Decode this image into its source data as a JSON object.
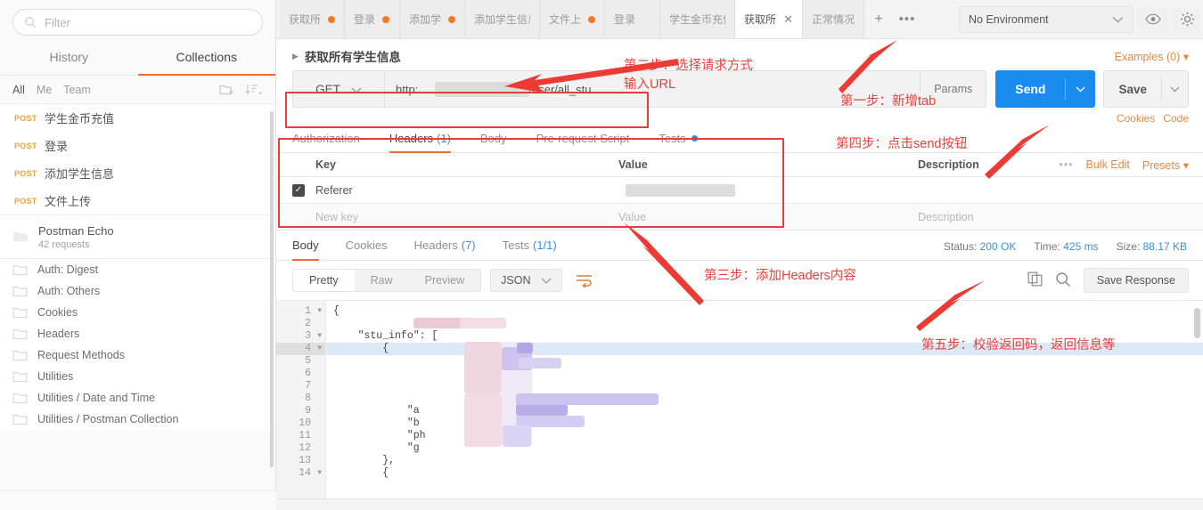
{
  "sidebar": {
    "filter_placeholder": "Filter",
    "tabs": [
      {
        "label": "History",
        "active": false
      },
      {
        "label": "Collections",
        "active": true
      }
    ],
    "scope_filters": [
      {
        "label": "All",
        "active": true
      },
      {
        "label": "Me",
        "active": false
      },
      {
        "label": "Team",
        "active": false
      }
    ],
    "new_folder_icon": "new-folder-icon",
    "sort_icon": "sort-descending-icon",
    "requests": [
      {
        "method": "POST",
        "name": "学生金币充值"
      },
      {
        "method": "POST",
        "name": "登录"
      },
      {
        "method": "POST",
        "name": "添加学生信息"
      },
      {
        "method": "POST",
        "name": "文件上传"
      }
    ],
    "collection": {
      "name": "Postman Echo",
      "meta": "42 requests"
    },
    "folders": [
      "Auth: Digest",
      "Auth: Others",
      "Cookies",
      "Headers",
      "Request Methods",
      "Utilities",
      "Utilities / Date and Time",
      "Utilities / Postman Collection"
    ]
  },
  "tabbar": {
    "tabs": [
      {
        "label": "获取所",
        "dirty": true,
        "active": false,
        "closable": false
      },
      {
        "label": "登录",
        "dirty": true,
        "active": false,
        "closable": false
      },
      {
        "label": "添加学",
        "dirty": true,
        "active": false,
        "closable": false
      },
      {
        "label": "添加学生信息",
        "dirty": false,
        "active": false,
        "closable": false
      },
      {
        "label": "文件上",
        "dirty": true,
        "active": false,
        "closable": false
      },
      {
        "label": "登录",
        "dirty": false,
        "active": false,
        "closable": false
      },
      {
        "label": "学生金币充值",
        "dirty": false,
        "active": false,
        "closable": false
      },
      {
        "label": "获取所",
        "dirty": false,
        "active": true,
        "closable": true
      },
      {
        "label": "正常情况",
        "dirty": false,
        "active": false,
        "closable": false
      }
    ],
    "add_label": "+",
    "more_label": "•••",
    "environment": "No Environment",
    "eye_icon": "eye-icon",
    "gear_icon": "gear-icon"
  },
  "request": {
    "title": "获取所有学生信息",
    "examples_label": "Examples (0)",
    "method": "GET",
    "url_prefix": "http:",
    "url_suffix": "pi/user/all_stu",
    "params_label": "Params",
    "send_label": "Send",
    "save_label": "Save",
    "cookies_label": "Cookies",
    "code_label": "Code",
    "tabs": [
      {
        "label": "Authorization",
        "count": "",
        "active": false,
        "dot": false
      },
      {
        "label": "Headers",
        "count": "(1)",
        "active": true,
        "dot": false
      },
      {
        "label": "Body",
        "count": "",
        "active": false,
        "dot": false
      },
      {
        "label": "Pre-request Script",
        "count": "",
        "active": false,
        "dot": false
      },
      {
        "label": "Tests",
        "count": "",
        "active": false,
        "dot": true
      }
    ],
    "headers_table": {
      "columns": [
        "Key",
        "Value",
        "Description"
      ],
      "bulk_edit_label": "Bulk Edit",
      "presets_label": "Presets",
      "more_label": "•••",
      "rows": [
        {
          "checked": true,
          "key": "Referer",
          "value": "",
          "description": ""
        }
      ],
      "new_row": {
        "key": "New key",
        "value": "Value",
        "description": "Description"
      }
    }
  },
  "response": {
    "tabs": [
      {
        "label": "Body",
        "count": "",
        "active": true
      },
      {
        "label": "Cookies",
        "count": "",
        "active": false
      },
      {
        "label": "Headers",
        "count": "(7)",
        "active": false
      },
      {
        "label": "Tests",
        "count": "(1/1)",
        "active": false
      }
    ],
    "status_label": "Status:",
    "status_value": "200 OK",
    "time_label": "Time:",
    "time_value": "425 ms",
    "size_label": "Size:",
    "size_value": "88.17 KB",
    "view_modes": [
      {
        "label": "Pretty",
        "active": true
      },
      {
        "label": "Raw",
        "active": false
      },
      {
        "label": "Preview",
        "active": false
      }
    ],
    "format": "JSON",
    "wrap_icon": "word-wrap-icon",
    "copy_icon": "copy-icon",
    "search_icon": "search-icon",
    "save_response_label": "Save Response",
    "code_lines": [
      {
        "n": "1",
        "fold": true,
        "text": "{",
        "hl": false
      },
      {
        "n": "2",
        "fold": false,
        "text": "",
        "hl": false
      },
      {
        "n": "3",
        "fold": true,
        "text": "    \"stu_info\": [",
        "hl": false
      },
      {
        "n": "4",
        "fold": true,
        "text": "        {",
        "hl": true
      },
      {
        "n": "5",
        "fold": false,
        "text": "",
        "hl": false
      },
      {
        "n": "6",
        "fold": false,
        "text": "",
        "hl": false
      },
      {
        "n": "7",
        "fold": false,
        "text": "",
        "hl": false
      },
      {
        "n": "8",
        "fold": false,
        "text": "",
        "hl": false
      },
      {
        "n": "9",
        "fold": false,
        "text": "            \"a",
        "hl": false
      },
      {
        "n": "10",
        "fold": false,
        "text": "            \"b",
        "hl": false
      },
      {
        "n": "11",
        "fold": false,
        "text": "            \"ph",
        "hl": false
      },
      {
        "n": "12",
        "fold": false,
        "text": "            \"g",
        "hl": false
      },
      {
        "n": "13",
        "fold": false,
        "text": "        },",
        "hl": false
      },
      {
        "n": "14",
        "fold": true,
        "text": "        {",
        "hl": false
      }
    ]
  },
  "annotations": [
    {
      "id": "step1",
      "text": "第一步：新增tab"
    },
    {
      "id": "step2",
      "text": "第二步：选择请求方式\n输入URL"
    },
    {
      "id": "step3",
      "text": "第三步：添加Headers内容"
    },
    {
      "id": "step4",
      "text": "第四步：点击send按钮"
    },
    {
      "id": "step5",
      "text": "第五步：校验返回码，返回信息等"
    }
  ],
  "colors": {
    "accent_orange": "#ef6c2e",
    "send_blue": "#1a8cf0",
    "annotation_red": "#e8403a",
    "method_post": "#e8a33d",
    "status_blue": "#3a8fd8"
  }
}
